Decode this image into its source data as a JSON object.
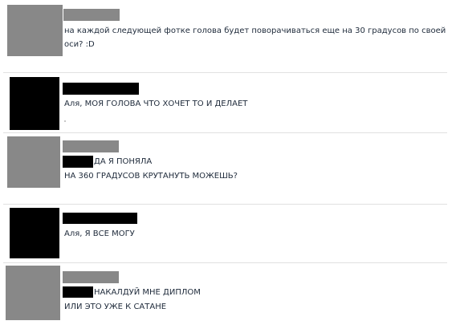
{
  "comments": [
    {
      "lines": [
        "на каждой следующей фотке голова будет поворачиваться еще на 30 градусов по своей",
        "оси? :D"
      ]
    },
    {
      "lines": [
        "Аля, МОЯ ГОЛОВА ЧТО ХОЧЕТ ТО И ДЕЛАЕТ"
      ]
    },
    {
      "lines": [
        "ДА Я ПОНЯЛА",
        "НА 360 ГРАДУСОВ КРУТАНУТЬ МОЖЕШЬ?"
      ]
    },
    {
      "lines": [
        "Аля, Я ВСЕ МОГУ"
      ]
    },
    {
      "lines": [
        "НАКАЛДУЙ МНЕ ДИПЛОМ",
        "ИЛИ ЭТО УЖЕ К САТАНЕ"
      ]
    }
  ],
  "colors": {
    "redacted_gray": "#888888",
    "redacted_black": "#000000",
    "divider": "#e1e1e1",
    "text": "#1e2a3a"
  }
}
